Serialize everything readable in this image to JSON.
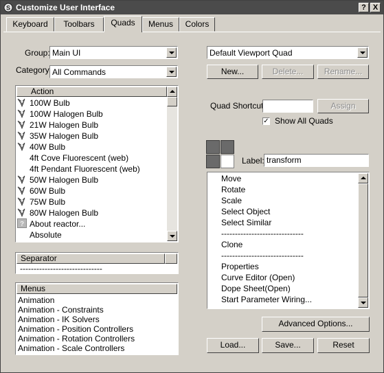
{
  "window": {
    "title": "Customize User Interface",
    "help_label": "?",
    "close_label": "X"
  },
  "tabs": [
    {
      "label": "Keyboard",
      "active": false
    },
    {
      "label": "Toolbars",
      "active": false
    },
    {
      "label": "Quads",
      "active": true
    },
    {
      "label": "Menus",
      "active": false
    },
    {
      "label": "Colors",
      "active": false
    }
  ],
  "left": {
    "group_label": "Group:",
    "group_value": "Main UI",
    "category_label": "Category:",
    "category_value": "All Commands",
    "action_header": "Action",
    "actions": [
      {
        "label": "100W Bulb",
        "icon": "bulb-icon"
      },
      {
        "label": "100W Halogen Bulb",
        "icon": "bulb-icon"
      },
      {
        "label": "21W Halogen Bulb",
        "icon": "bulb-icon"
      },
      {
        "label": "35W Halogen Bulb",
        "icon": "bulb-icon"
      },
      {
        "label": "40W Bulb",
        "icon": "bulb-icon"
      },
      {
        "label": "4ft Cove Fluorescent (web)",
        "icon": ""
      },
      {
        "label": "4ft Pendant Fluorescent (web)",
        "icon": ""
      },
      {
        "label": "50W Halogen Bulb",
        "icon": "bulb-icon"
      },
      {
        "label": "60W Bulb",
        "icon": "bulb-icon"
      },
      {
        "label": "75W Bulb",
        "icon": "bulb-icon"
      },
      {
        "label": "80W Halogen Bulb",
        "icon": "bulb-icon"
      },
      {
        "label": "About reactor...",
        "icon": "reactor-icon"
      },
      {
        "label": "Absolute",
        "icon": ""
      }
    ],
    "separator_header": "Separator",
    "separator_item": "------------------------------",
    "menus_header": "Menus",
    "menus": [
      "Animation",
      "Animation - Constraints",
      "Animation - IK Solvers",
      "Animation - Position Controllers",
      "Animation - Rotation Controllers",
      "Animation - Scale Controllers"
    ]
  },
  "right": {
    "quad_set_value": "Default Viewport Quad",
    "new_label": "New...",
    "delete_label": "Delete...",
    "rename_label": "Rename...",
    "quad_shortcut_label": "Quad Shortcut:",
    "quad_shortcut_value": "",
    "assign_label": "Assign",
    "show_all_quads_label": "Show All Quads",
    "show_all_quads_checked": true,
    "check_mark": "✓",
    "label_caption": "Label:",
    "label_value": "transform",
    "quad_items": [
      "Move",
      "Rotate",
      "Scale",
      "Select Object",
      "Select Similar",
      "------------------------------",
      "Clone",
      "------------------------------",
      "Properties",
      "Curve Editor (Open)",
      "Dope Sheet(Open)",
      "Start Parameter Wiring..."
    ],
    "advanced_options_label": "Advanced Options...",
    "load_label": "Load...",
    "save_label": "Save...",
    "reset_label": "Reset"
  }
}
